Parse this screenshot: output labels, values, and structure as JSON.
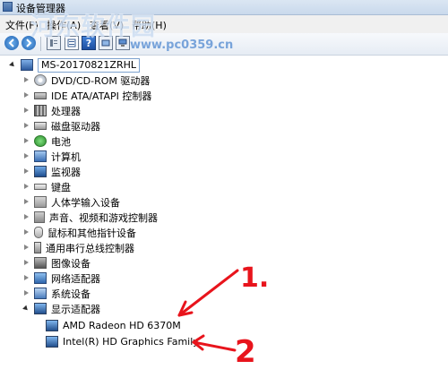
{
  "window": {
    "title": "设备管理器"
  },
  "menu": [
    {
      "label": "文件(F)"
    },
    {
      "label": "操作(A)"
    },
    {
      "label": "查看(V)"
    },
    {
      "label": "帮助(H)"
    }
  ],
  "watermark": {
    "text": "河东软件园",
    "url": "www.pc0359.cn"
  },
  "toolbar": {
    "icons": [
      "back-icon",
      "forward-icon",
      "properties-icon",
      "help-icon",
      "scan-icon",
      "computer-icon"
    ]
  },
  "tree": {
    "root": {
      "label": "MS-20170821ZRHL",
      "icon": "computer-icon"
    },
    "categories": [
      {
        "label": "DVD/CD-ROM 驱动器",
        "icon": "dvd-drive-icon"
      },
      {
        "label": "IDE ATA/ATAPI 控制器",
        "icon": "ide-controller-icon"
      },
      {
        "label": "处理器",
        "icon": "processor-icon"
      },
      {
        "label": "磁盘驱动器",
        "icon": "disk-drive-icon"
      },
      {
        "label": "电池",
        "icon": "battery-icon"
      },
      {
        "label": "计算机",
        "icon": "computer-icon"
      },
      {
        "label": "监视器",
        "icon": "monitor-icon"
      },
      {
        "label": "键盘",
        "icon": "keyboard-icon"
      },
      {
        "label": "人体学输入设备",
        "icon": "hid-icon"
      },
      {
        "label": "声音、视频和游戏控制器",
        "icon": "sound-icon"
      },
      {
        "label": "鼠标和其他指针设备",
        "icon": "mouse-icon"
      },
      {
        "label": "通用串行总线控制器",
        "icon": "usb-icon"
      },
      {
        "label": "图像设备",
        "icon": "camera-icon"
      },
      {
        "label": "网络适配器",
        "icon": "network-adapter-icon"
      },
      {
        "label": "系统设备",
        "icon": "system-device-icon"
      },
      {
        "label": "显示适配器",
        "icon": "display-adapter-icon",
        "expanded": true
      }
    ],
    "display_adapters": [
      {
        "label": "AMD Radeon HD 6370M",
        "icon": "display-device-icon"
      },
      {
        "label": "Intel(R) HD Graphics Family",
        "icon": "display-device-icon"
      }
    ]
  },
  "annotations": {
    "label1": "1.",
    "label2": "2",
    "color": "#e8141c"
  }
}
